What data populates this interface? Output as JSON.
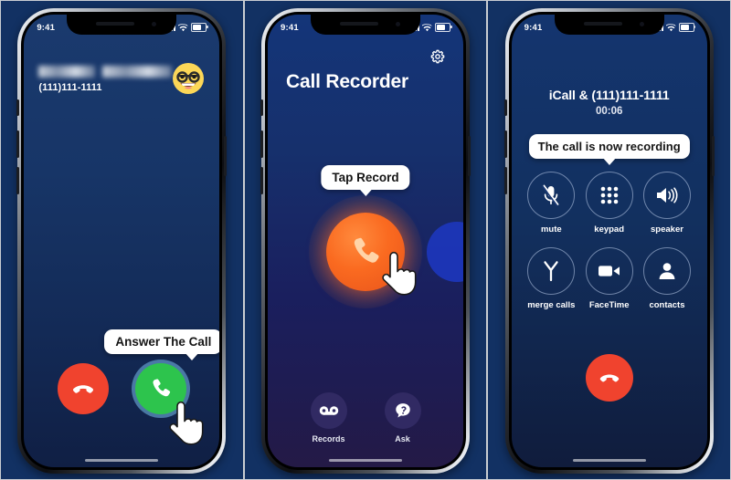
{
  "panels": [
    {
      "id": "incoming-call",
      "status_bar": {
        "time": "9:41",
        "signal": "signal-bars-icon",
        "wifi": "wifi-icon",
        "battery": "battery-icon"
      },
      "caller": {
        "name_redacted": true,
        "number": "(111)111-1111",
        "emoji": "nerd-face-emoji"
      },
      "tooltip": "Answer The Call",
      "buttons": [
        {
          "name": "decline-call-button",
          "icon": "phone-down-icon",
          "color": "#f0432e"
        },
        {
          "name": "accept-call-button",
          "icon": "phone-icon",
          "color": "#2dc44d"
        }
      ],
      "cursor": "pointing-hand-cursor"
    },
    {
      "id": "call-recorder-home",
      "status_bar": {
        "time": "9:41",
        "signal": "signal-bars-icon",
        "wifi": "wifi-icon",
        "battery": "battery-icon"
      },
      "app_title": "Call Recorder",
      "settings_icon": "gear-icon",
      "tooltip": "Tap Record",
      "record_button": {
        "name": "record-button",
        "icon": "phone-icon",
        "color": "#fa6a20"
      },
      "tabs": [
        {
          "label": "Records",
          "icon": "voicemail-icon"
        },
        {
          "label": "Ask",
          "icon": "question-chat-icon"
        }
      ],
      "cursor": "pointing-hand-cursor"
    },
    {
      "id": "active-call",
      "status_bar": {
        "time": "9:41",
        "signal": "signal-bars-icon",
        "wifi": "wifi-icon",
        "battery": "battery-icon"
      },
      "call_title": "iCall & (111)111-1111",
      "call_timer": "00:06",
      "tooltip": "The call is now recording",
      "controls": [
        {
          "label": "mute",
          "icon": "microphone-muted-icon"
        },
        {
          "label": "keypad",
          "icon": "keypad-icon"
        },
        {
          "label": "speaker",
          "icon": "speaker-icon"
        },
        {
          "label": "merge calls",
          "icon": "merge-calls-icon"
        },
        {
          "label": "FaceTime",
          "icon": "video-camera-icon"
        },
        {
          "label": "contacts",
          "icon": "person-icon"
        }
      ],
      "end_call": {
        "name": "end-call-button",
        "icon": "phone-down-icon",
        "color": "#f0432e"
      }
    }
  ],
  "colors": {
    "background": "#123163",
    "accent_orange": "#fa6a20",
    "accent_green": "#2dc44d",
    "accent_red": "#f0432e",
    "bubble": "#ffffff"
  }
}
